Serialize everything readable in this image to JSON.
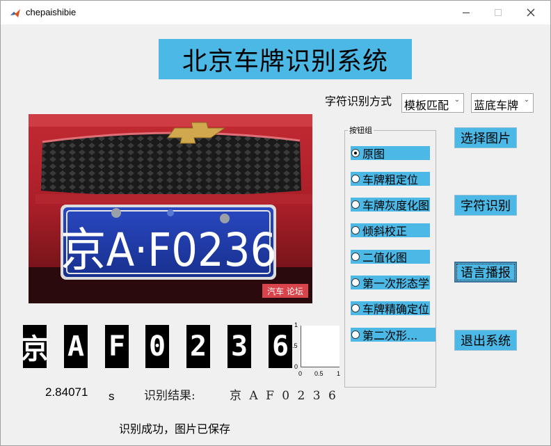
{
  "window": {
    "title": "chepaishibie",
    "minimize_icon": "minimize-icon",
    "maximize_icon": "maximize-icon",
    "close_icon": "close-icon"
  },
  "header": {
    "title": "北京车牌识别系统"
  },
  "controls": {
    "method_label": "字符识别方式",
    "method_select": {
      "selected": "模板匹配"
    },
    "plate_select": {
      "selected": "蓝底车牌"
    }
  },
  "plate_image": {
    "plate_text": "京A·F0236",
    "watermark": "汽车 论坛"
  },
  "segmented_chars": [
    "京",
    "A",
    "F",
    "0",
    "2",
    "3",
    "6"
  ],
  "mini_axes": {
    "y_ticks": [
      "1",
      "0.5",
      "0"
    ],
    "x_ticks": [
      "0",
      "0.5",
      "1"
    ]
  },
  "results": {
    "time_value": "2.84071",
    "time_unit": "s",
    "result_label": "识别结果:",
    "result_value": "京 A F 0 2 3 6",
    "status": "识别成功，图片已保存"
  },
  "button_group": {
    "label": "按钮组",
    "options": [
      {
        "label": "原图",
        "checked": true
      },
      {
        "label": "车牌粗定位",
        "checked": false
      },
      {
        "label": "车牌灰度化图",
        "checked": false
      },
      {
        "label": "倾斜校正",
        "checked": false
      },
      {
        "label": "二值化图",
        "checked": false
      },
      {
        "label": "第一次形态学",
        "checked": false
      },
      {
        "label": "车牌精确定位",
        "checked": false
      },
      {
        "label": "第二次形...",
        "checked": false
      }
    ]
  },
  "buttons": {
    "select_image": "选择图片",
    "char_recognize": "字符识别",
    "voice_broadcast": "语言播报",
    "exit": "退出系统"
  },
  "colors": {
    "accent": "#4bb8e6",
    "plate_blue": "#1f3aa6",
    "car_red": "#b8202c"
  }
}
